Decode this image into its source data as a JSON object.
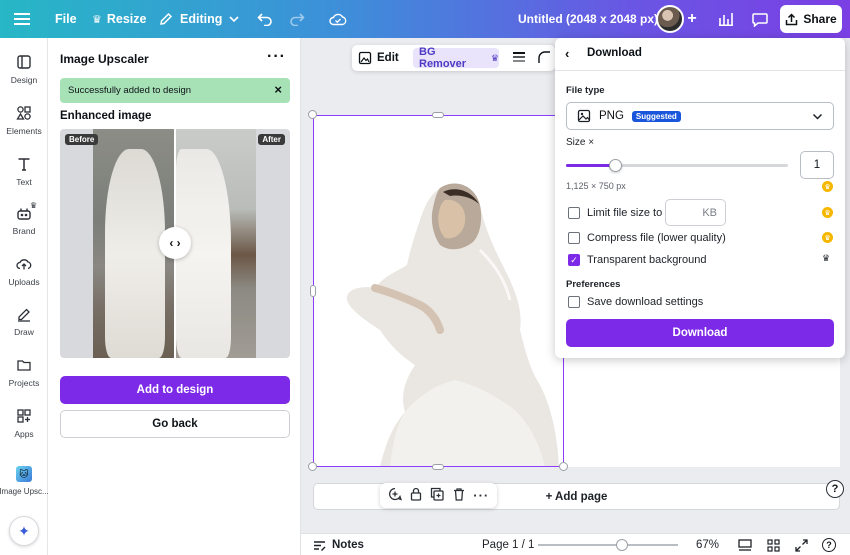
{
  "topbar": {
    "file_label": "File",
    "resize_label": "Resize",
    "editing_label": "Editing",
    "doc_title": "Untitled (2048 x 2048 px)",
    "share_label": "Share"
  },
  "rail": {
    "items": [
      {
        "label": "Design",
        "icon": "design-icon"
      },
      {
        "label": "Elements",
        "icon": "elements-icon"
      },
      {
        "label": "Text",
        "icon": "text-icon"
      },
      {
        "label": "Brand",
        "icon": "brand-icon"
      },
      {
        "label": "Uploads",
        "icon": "uploads-icon"
      },
      {
        "label": "Draw",
        "icon": "draw-icon"
      },
      {
        "label": "Projects",
        "icon": "projects-icon"
      },
      {
        "label": "Apps",
        "icon": "apps-icon"
      },
      {
        "label": "Image Upsc...",
        "icon": "image-upscaler-app-icon"
      }
    ]
  },
  "panel": {
    "title": "Image Upscaler",
    "toast": "Successfully added to design",
    "section_label": "Enhanced image",
    "before_tag": "Before",
    "after_tag": "After",
    "add_button": "Add to design",
    "back_button": "Go back"
  },
  "editbar": {
    "edit_label": "Edit",
    "bg_remover_label": "BG Remover"
  },
  "canvas": {
    "add_page_label": "+ Add page",
    "help_label": "?"
  },
  "bottombar": {
    "notes_label": "Notes",
    "page_indicator": "Page 1 / 1",
    "zoom_label": "67%",
    "zoom_level_fraction": 0.6
  },
  "download": {
    "title": "Download",
    "file_type_label": "File type",
    "file_type_value": "PNG",
    "suggested_badge": "Suggested",
    "size_label": "Size ×",
    "size_value": "1",
    "size_slider_fraction": 0.22,
    "dimensions": "1,125 × 750 px",
    "limit_label": "Limit file size to",
    "kb_placeholder": "KB",
    "compress_label": "Compress file (lower quality)",
    "transparent_label": "Transparent background",
    "transparent_checked": true,
    "preferences_label": "Preferences",
    "save_settings_label": "Save download settings",
    "button_label": "Download"
  },
  "colors": {
    "accent": "#7d2ae8",
    "toast_bg": "#a7e1b6",
    "crown": "#f5b700"
  }
}
